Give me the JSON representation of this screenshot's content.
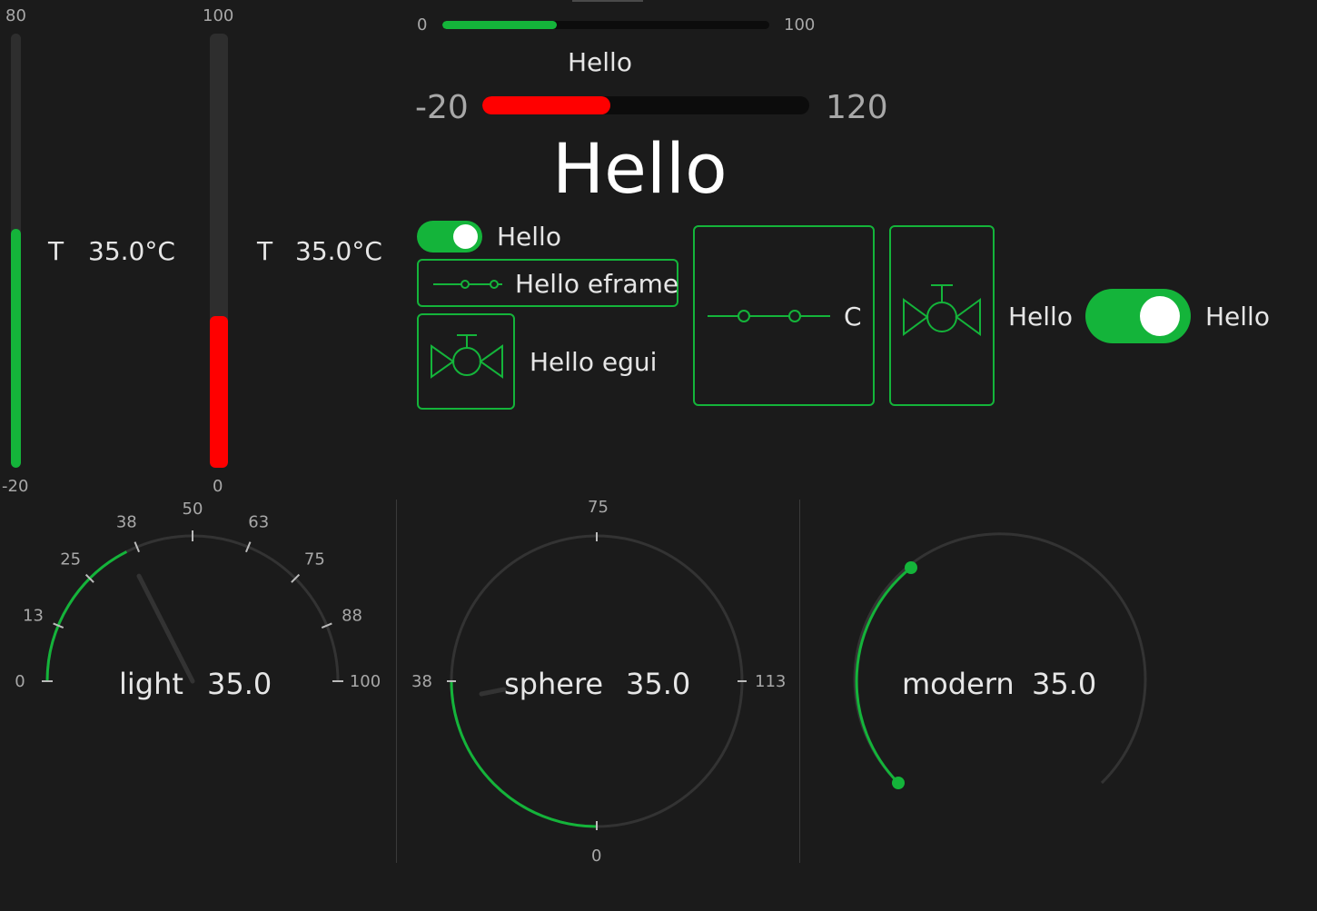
{
  "colors": {
    "green": "#14b43a",
    "red": "#ff0000",
    "track": "#2e2e2e",
    "dark_track": "#0c0c0c",
    "text": "#e6e6e6",
    "muted": "#a8a8a8"
  },
  "thermo1": {
    "max": "80",
    "min": "-20",
    "label": "T",
    "value_text": "35.0°C",
    "value": 35,
    "range": [
      -20,
      80
    ],
    "color": "green"
  },
  "thermo2": {
    "max": "100",
    "min": "0",
    "label": "T",
    "value_text": "35.0°C",
    "value": 35,
    "range": [
      0,
      100
    ],
    "color": "red"
  },
  "slider_small": {
    "min": "0",
    "max": "100",
    "value": 35
  },
  "progress": {
    "title": "Hello",
    "min": "-20",
    "max": "120",
    "value": 35
  },
  "big_title": "Hello",
  "toggle_small": {
    "label": "Hello",
    "on": true
  },
  "button_eframe": {
    "label": "Hello eframe",
    "icon": "switch-icon"
  },
  "button_egui": {
    "label": "Hello egui",
    "icon": "valve-icon"
  },
  "button_c": {
    "label": "C",
    "icon": "switch-icon"
  },
  "button_valve": {
    "icon": "valve-icon"
  },
  "toggle_large": {
    "left_label": "Hello",
    "right_label": "Hello",
    "on": true
  },
  "gauges": {
    "light": {
      "name": "light",
      "value_text": "35.0",
      "value": 35,
      "ticks": [
        "0",
        "13",
        "25",
        "38",
        "50",
        "63",
        "75",
        "88",
        "100"
      ]
    },
    "sphere": {
      "name": "sphere",
      "value_text": "35.0",
      "value": 35,
      "ticks": {
        "top": "75",
        "left": "38",
        "right": "113",
        "bottom": "0"
      }
    },
    "modern": {
      "name": "modern",
      "value_text": "35.0",
      "value": 35
    }
  }
}
